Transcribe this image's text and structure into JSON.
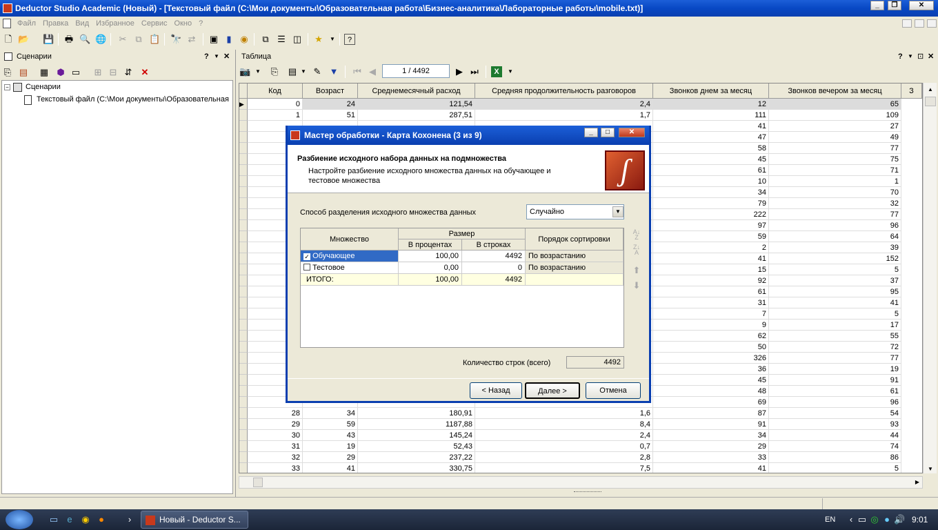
{
  "window": {
    "title": "Deductor Studio Academic (Новый) - [Текстовый файл (C:\\Мои документы\\Образовательная работа\\Бизнес-аналитика\\Лабораторные работы\\mobile.txt)]"
  },
  "menu": [
    "Файл",
    "Правка",
    "Вид",
    "Избранное",
    "Сервис",
    "Окно",
    "?"
  ],
  "left_panel": {
    "title": "Сценарии",
    "tree_root": "Сценарии",
    "tree_child": "Текстовый файл (C:\\Мои документы\\Образовательная"
  },
  "right_panel": {
    "title": "Таблица",
    "record_position": "1 / 4492"
  },
  "table": {
    "columns": [
      "Код",
      "Возраст",
      "Среднемесячный расход",
      "Средняя продолжительность разговоров",
      "Звонков днем за месяц",
      "Звонков вечером за месяц",
      "З"
    ],
    "rows": [
      [
        "0",
        "24",
        "121,54",
        "2,4",
        "12",
        "65"
      ],
      [
        "1",
        "51",
        "287,51",
        "1,7",
        "111",
        "109"
      ],
      [
        "",
        "",
        "",
        "",
        "41",
        "27"
      ],
      [
        "",
        "",
        "",
        "",
        "47",
        "49"
      ],
      [
        "",
        "",
        "",
        "",
        "58",
        "77"
      ],
      [
        "",
        "",
        "",
        "",
        "45",
        "75"
      ],
      [
        "",
        "",
        "",
        "",
        "61",
        "71"
      ],
      [
        "",
        "",
        "",
        "",
        "10",
        "1"
      ],
      [
        "",
        "",
        "",
        "",
        "34",
        "70"
      ],
      [
        "",
        "",
        "",
        "",
        "79",
        "32"
      ],
      [
        "",
        "",
        "",
        "",
        "222",
        "77"
      ],
      [
        "",
        "",
        "",
        "",
        "97",
        "96"
      ],
      [
        "",
        "",
        "",
        "",
        "59",
        "64"
      ],
      [
        "",
        "",
        "",
        "",
        "2",
        "39"
      ],
      [
        "",
        "",
        "",
        "",
        "41",
        "152"
      ],
      [
        "",
        "",
        "",
        "",
        "15",
        "5"
      ],
      [
        "",
        "",
        "",
        "",
        "92",
        "37"
      ],
      [
        "",
        "",
        "",
        "",
        "61",
        "95"
      ],
      [
        "",
        "",
        "",
        "",
        "31",
        "41"
      ],
      [
        "",
        "",
        "",
        "",
        "7",
        "5"
      ],
      [
        "",
        "",
        "",
        "",
        "9",
        "17"
      ],
      [
        "",
        "",
        "",
        "",
        "62",
        "55"
      ],
      [
        "",
        "",
        "",
        "",
        "50",
        "72"
      ],
      [
        "",
        "",
        "",
        "",
        "326",
        "77"
      ],
      [
        "",
        "",
        "",
        "",
        "36",
        "19"
      ],
      [
        "",
        "",
        "",
        "",
        "45",
        "91"
      ],
      [
        "",
        "",
        "",
        "",
        "48",
        "61"
      ],
      [
        "",
        "",
        "",
        "",
        "69",
        "96"
      ],
      [
        "28",
        "34",
        "180,91",
        "1,6",
        "87",
        "54"
      ],
      [
        "29",
        "59",
        "1187,88",
        "8,4",
        "91",
        "93"
      ],
      [
        "30",
        "43",
        "145,24",
        "2,4",
        "34",
        "44"
      ],
      [
        "31",
        "19",
        "52,43",
        "0,7",
        "29",
        "74"
      ],
      [
        "32",
        "29",
        "237,22",
        "2,8",
        "33",
        "86"
      ],
      [
        "33",
        "41",
        "330,75",
        "7,5",
        "41",
        "5"
      ]
    ]
  },
  "dialog": {
    "title": "Мастер обработки - Карта Кохонена (3 из 9)",
    "heading": "Разбиение исходного набора данных на подмножества",
    "description_line1": "Настройте разбиение исходного множества данных на обучающее и",
    "description_line2": "тестовое множества",
    "split_label": "Способ разделения исходного множества данных",
    "split_value": "Случайно",
    "grid_headers": {
      "set": "Множество",
      "size": "Размер",
      "percent": "В процентах",
      "rows": "В строках",
      "order": "Порядок сортировки"
    },
    "grid_rows": [
      {
        "name": "Обучающее",
        "checked": true,
        "percent": "100,00",
        "rows": "4492",
        "order": "По возрастанию"
      },
      {
        "name": "Тестовое",
        "checked": false,
        "percent": "0,00",
        "rows": "0",
        "order": "По возрастанию"
      }
    ],
    "total": {
      "name": "ИТОГО:",
      "percent": "100,00",
      "rows": "4492"
    },
    "row_count_label": "Количество строк (всего)",
    "row_count_value": "4492",
    "buttons": {
      "back": "< Назад",
      "next": "Далее >",
      "cancel": "Отмена"
    }
  },
  "taskbar": {
    "task": "Новый - Deductor S...",
    "lang": "EN",
    "time": "9:01"
  }
}
